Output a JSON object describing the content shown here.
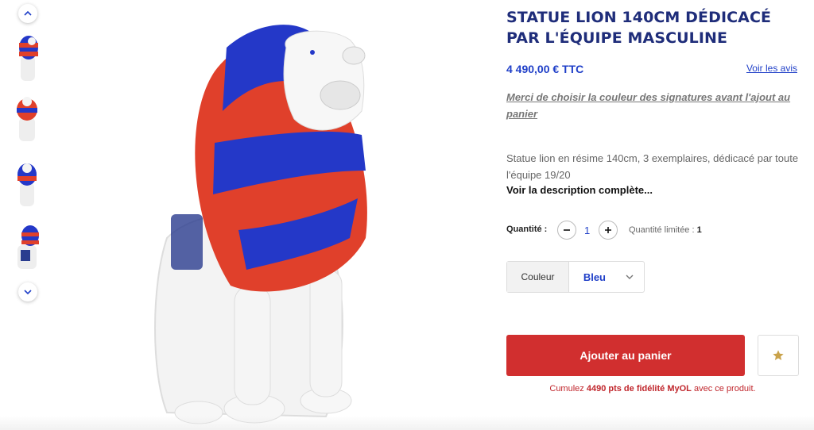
{
  "product": {
    "title_line1": "STATUE LION 140CM DÉDICACÉ",
    "title_line2": "PAR L'ÉQUIPE MASCULINE",
    "price": "4 490,00 € TTC",
    "reviews_link": "Voir les avis",
    "notice": "Merci de choisir la couleur des signatures avant l'ajout au panier",
    "description": "Statue lion en résime 140cm, 3 exemplaires, dédicacé par toute l'équipe 19/20",
    "more_link": "Voir la description complète..."
  },
  "quantity": {
    "label": "Quantité :",
    "value": "1",
    "limit_prefix": "Quantité limitée :",
    "limit_value": "1"
  },
  "color": {
    "label": "Couleur",
    "selected": "Bleu"
  },
  "actions": {
    "add_to_cart": "Ajouter au panier"
  },
  "loyalty": {
    "prefix": "Cumulez",
    "points": "4490 pts de fidélité MyOL",
    "suffix": "avec ce produit."
  },
  "icons": {
    "up": "chevron-up-icon",
    "down": "chevron-down-icon",
    "minus": "minus-icon",
    "plus": "plus-icon",
    "select": "chevron-down-icon",
    "favorite": "star-icon"
  },
  "colors": {
    "title": "#1f2d7a",
    "accent_blue": "#1f3fc8",
    "cta_red": "#d12f2f",
    "star": "#c9a24a"
  }
}
